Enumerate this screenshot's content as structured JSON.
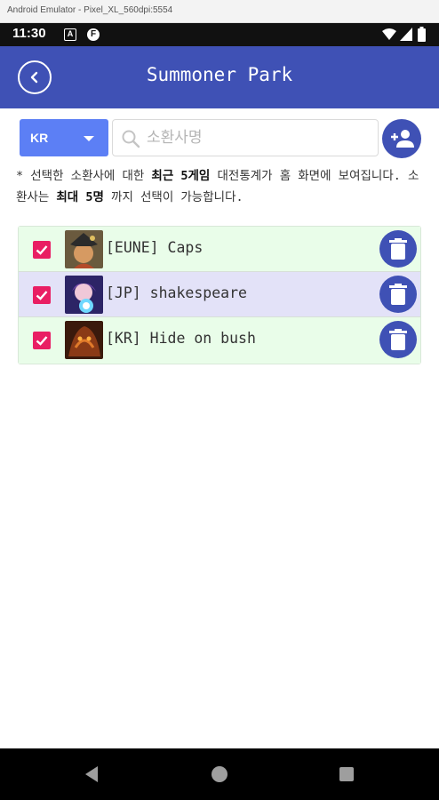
{
  "emulator": {
    "title": "Android Emulator - Pixel_XL_560dpi:5554"
  },
  "status_bar": {
    "time": "11:30",
    "icon_a": "A",
    "icon_f": "F"
  },
  "app_bar": {
    "title": "Summoner Park"
  },
  "search": {
    "region": "KR",
    "placeholder": "소환사명",
    "value": ""
  },
  "notice": {
    "prefix": "* 선택한 소환사에 대한 ",
    "bold1": "최근 5게임",
    "middle": " 대전통계가 홈 화면에 보여집니다. 소환사는 ",
    "bold2": "최대 5명",
    "suffix": " 까지 선택이 가능합니다."
  },
  "summoners": [
    {
      "label": "[EUNE] Caps",
      "checked": true,
      "highlight": "green"
    },
    {
      "label": "[JP] shakespeare",
      "checked": true,
      "highlight": "purple"
    },
    {
      "label": "[KR] Hide on bush",
      "checked": true,
      "highlight": "green"
    }
  ],
  "colors": {
    "primary": "#3f51b5",
    "region": "#5c7ff5",
    "checkbox": "#e91e63",
    "row_green": "#e9fde9",
    "row_purple": "#e3e2f8"
  },
  "icons": [
    "back-arrow-icon",
    "search-icon",
    "add-person-icon",
    "check-icon",
    "trash-icon"
  ]
}
